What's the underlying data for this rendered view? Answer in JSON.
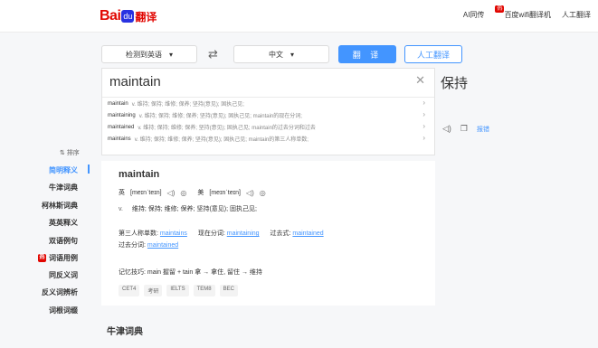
{
  "header": {
    "logo_bai": "Bai",
    "logo_paw": "du",
    "logo_fanyi": "翻译",
    "links": [
      {
        "label": "AI同传",
        "badge": "热"
      },
      {
        "label": "百度wifi翻译机"
      },
      {
        "label": "人工翻译"
      }
    ]
  },
  "langbar": {
    "source_lang": "检测到英语",
    "target_lang": "中文",
    "translate_button": "翻 译",
    "human_button": "人工翻译",
    "swap_icon": "swap-arrows-icon"
  },
  "input": {
    "text": "maintain",
    "suggestions": [
      {
        "word": "maintain",
        "def": "v. 维持; 保持; 维修; 保养; 坚持(意见); 固执己见;"
      },
      {
        "word": "maintaining",
        "def": "v. 维持; 保持; 维修; 保养; 坚持(意见); 固执己见; maintain的现在分词;"
      },
      {
        "word": "maintained",
        "def": "v. 维持; 保持; 维修; 保养; 坚持(意见); 固执己见; maintain的过去分词和过去"
      },
      {
        "word": "maintains",
        "def": "v. 维持; 保持; 维修; 保养; 坚持(意见); 固执己见; maintain的第三人称单数;"
      }
    ]
  },
  "output": {
    "text": "保持",
    "report_label": "报错"
  },
  "sidenav": {
    "sort_label": "⇅ 排序",
    "items": [
      {
        "label": "简明释义",
        "active": true
      },
      {
        "label": "牛津词典"
      },
      {
        "label": "柯林斯词典"
      },
      {
        "label": "英英释义"
      },
      {
        "label": "双语例句"
      },
      {
        "label": "词语用例",
        "badge": "热"
      },
      {
        "label": "同反义词"
      },
      {
        "label": "反义词辨析"
      },
      {
        "label": "词根词缀"
      }
    ]
  },
  "dict": {
    "word": "maintain",
    "uk_label": "英",
    "uk_phonetic": "[meɪnˈteɪn]",
    "us_label": "美",
    "us_phonetic": "[meɪnˈteɪn]",
    "pos": "v.",
    "definition": "维持; 保持; 维修; 保养; 坚持(意见); 固执己见;",
    "third_person_label": "第三人称单数:",
    "third_person": "maintains",
    "present_participle_label": "现在分词:",
    "present_participle": "maintaining",
    "past_tense_label": "过去式:",
    "past_tense": "maintained",
    "past_participle_label": "过去分词:",
    "past_participle": "maintained",
    "memo": "记忆技巧: main 握留 + tain 拿 → 拿住, 留住 → 维持",
    "tags": [
      "CET4",
      "考研",
      "IELTS",
      "TEM8",
      "BEC"
    ]
  },
  "oxford_title": "牛津词典"
}
